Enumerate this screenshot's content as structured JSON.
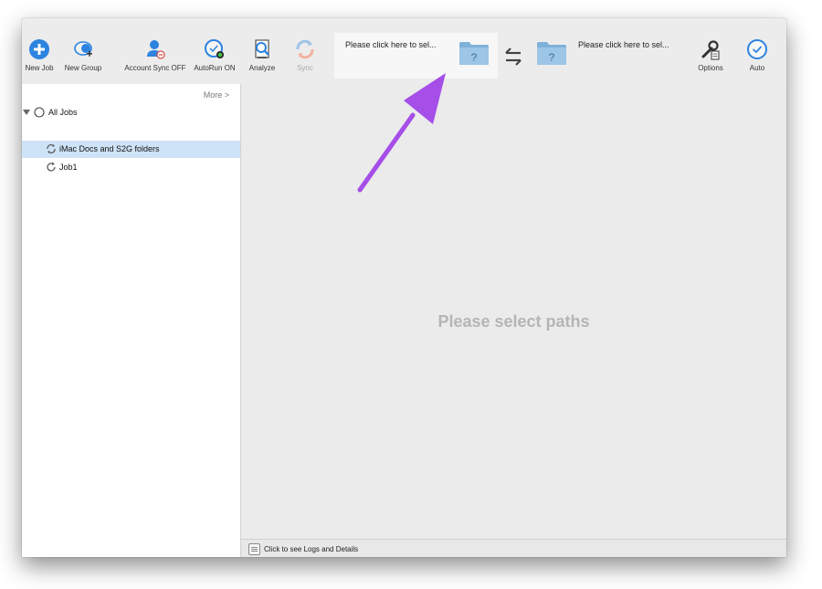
{
  "toolbar": {
    "new_job": "New Job",
    "new_group": "New Group",
    "account_sync": "Account Sync OFF",
    "autorun": "AutoRun ON",
    "analyze": "Analyze",
    "sync": "Sync",
    "options": "Options",
    "auto": "Auto"
  },
  "paths": {
    "left": "Please click here to sel...",
    "right": "Please click here to sel..."
  },
  "sidebar": {
    "more": "More >",
    "tree": {
      "root": "All Jobs",
      "items": [
        {
          "label": "iMac Docs and S2G folders",
          "selected": true
        },
        {
          "label": "Job1",
          "selected": false
        }
      ]
    }
  },
  "main": {
    "placeholder": "Please select paths"
  },
  "statusbar": {
    "text": "Click to see Logs and Details"
  },
  "colors": {
    "accent_blue": "#2d83e0",
    "selection": "#cfe3f7",
    "annotation_arrow": "#a64ee8",
    "folder_blue": "#7fb1d8"
  },
  "icons": {
    "new_job": "plus-circle-icon",
    "new_group": "group-add-icon",
    "account_sync": "user-sync-icon",
    "autorun": "clock-dot-icon",
    "analyze": "analyze-document-icon",
    "sync": "sync-arrows-icon",
    "swap": "swap-arrows-icon",
    "options": "wrench-options-icon",
    "auto": "auto-clock-icon",
    "folder": "folder-question-icon"
  }
}
